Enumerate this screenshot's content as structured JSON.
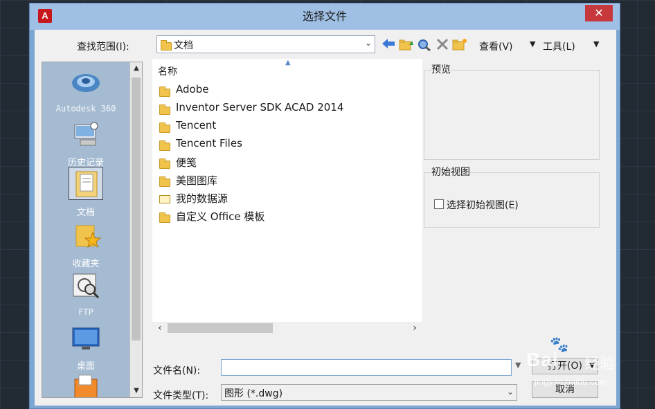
{
  "dialog": {
    "title": "选择文件",
    "app_icon": "autocad-logo",
    "close_label": "✕"
  },
  "toolbar": {
    "lookin_label": "查找范围(I):",
    "lookin_value": "文档",
    "back_icon": "back-arrow-icon",
    "up_folder_icon": "up-folder-icon",
    "search_web_icon": "search-web-icon",
    "delete_icon": "delete-icon",
    "new_folder_icon": "new-folder-icon",
    "view_menu": "查看(V)",
    "tools_menu": "工具(L)"
  },
  "places": [
    {
      "label": "Autodesk 360",
      "icon": "autodesk-360-icon"
    },
    {
      "label": "历史记录",
      "icon": "history-icon"
    },
    {
      "label": "文档",
      "icon": "documents-icon",
      "selected": true
    },
    {
      "label": "收藏夹",
      "icon": "favorites-icon"
    },
    {
      "label": "FTP",
      "icon": "ftp-icon"
    },
    {
      "label": "桌面",
      "icon": "desktop-icon"
    }
  ],
  "filelist": {
    "column_name": "名称",
    "items": [
      {
        "name": "Adobe",
        "type": "folder"
      },
      {
        "name": "Inventor Server SDK ACAD 2014",
        "type": "folder"
      },
      {
        "name": "Tencent",
        "type": "folder"
      },
      {
        "name": "Tencent Files",
        "type": "folder"
      },
      {
        "name": "便笺",
        "type": "folder"
      },
      {
        "name": "美图图库",
        "type": "folder"
      },
      {
        "name": "我的数据源",
        "type": "datasource"
      },
      {
        "name": "自定义 Office 模板",
        "type": "folder"
      }
    ]
  },
  "preview": {
    "label": "预览"
  },
  "initial_view": {
    "group_label": "初始视图",
    "checkbox_label": "选择初始视图(E)",
    "checked": false
  },
  "filename": {
    "label": "文件名(N):",
    "value": ""
  },
  "filetype": {
    "label": "文件类型(T):",
    "value": "图形 (*.dwg)"
  },
  "buttons": {
    "open": "打开(O)",
    "cancel": "取消"
  },
  "watermark": {
    "logo": "Bai",
    "cn": "经验",
    "url": "jingyan.baidu.com"
  },
  "colors": {
    "titlebar": "#9fc0e4",
    "close": "#c7383d",
    "places_bg": "#a5bbd2",
    "frame": "#7ea6d3"
  }
}
